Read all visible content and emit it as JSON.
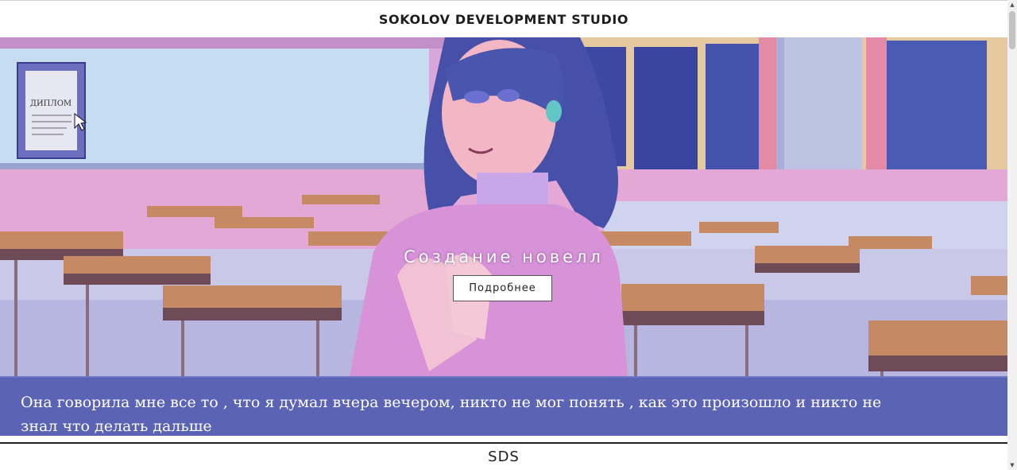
{
  "header": {
    "title": "SOKOLOV DEVELOPMENT STUDIO"
  },
  "hero": {
    "title": "Создание новелл",
    "button_label": "Подробнее",
    "diploma_text": "ДИПЛОМ",
    "dialogue": "Она говорила мне все то , что я думал вчера вечером, никто не мог понять , как это произошло и никто не знал что делать дальше"
  },
  "footer": {
    "label": "SDS"
  },
  "scrollbar": {
    "up_icon": "triangle-up-icon",
    "down_icon": "triangle-down-icon"
  },
  "colors": {
    "dialogue_bg": "#4650aa",
    "wall_pink": "#d9a6d8",
    "board": "#c9dff2",
    "window": "#3d4aa6"
  }
}
